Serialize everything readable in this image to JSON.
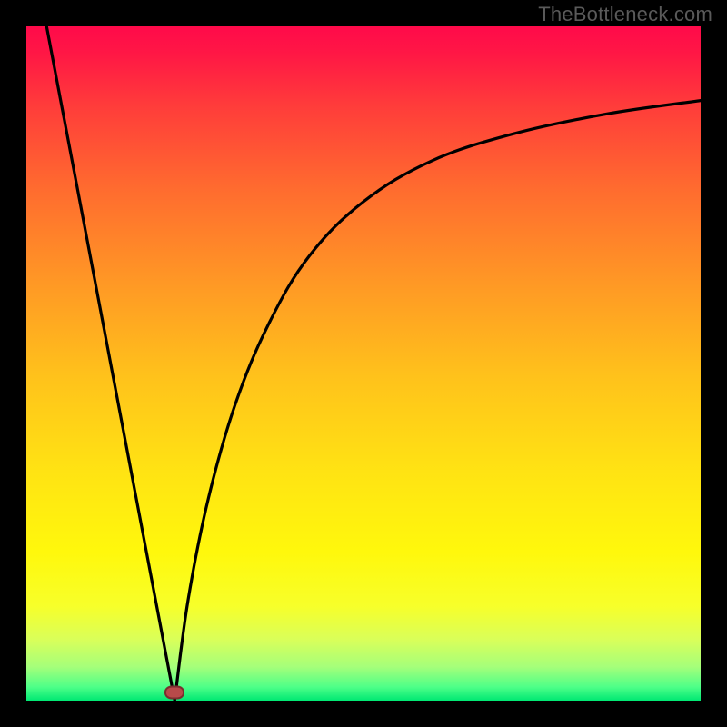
{
  "watermark": "TheBottleneck.com",
  "chart_data": {
    "type": "line",
    "title": "",
    "xlabel": "",
    "ylabel": "",
    "xlim": [
      0,
      100
    ],
    "ylim": [
      0,
      100
    ],
    "grid": false,
    "legend": false,
    "optimum_x": 22,
    "marker": {
      "x": 22,
      "y": 1.2,
      "color": "#b84a4a"
    },
    "background_gradient": {
      "top": "#ff0a4a",
      "mid": "#ffe313",
      "bottom": "#00e873"
    },
    "series": [
      {
        "name": "left",
        "x": [
          3,
          22
        ],
        "y": [
          100,
          0
        ]
      },
      {
        "name": "right",
        "x": [
          22,
          24,
          27,
          31,
          36,
          42,
          50,
          60,
          72,
          86,
          100
        ],
        "y": [
          0,
          15,
          30,
          44,
          56,
          66,
          74,
          80,
          84,
          87,
          89
        ]
      }
    ]
  }
}
